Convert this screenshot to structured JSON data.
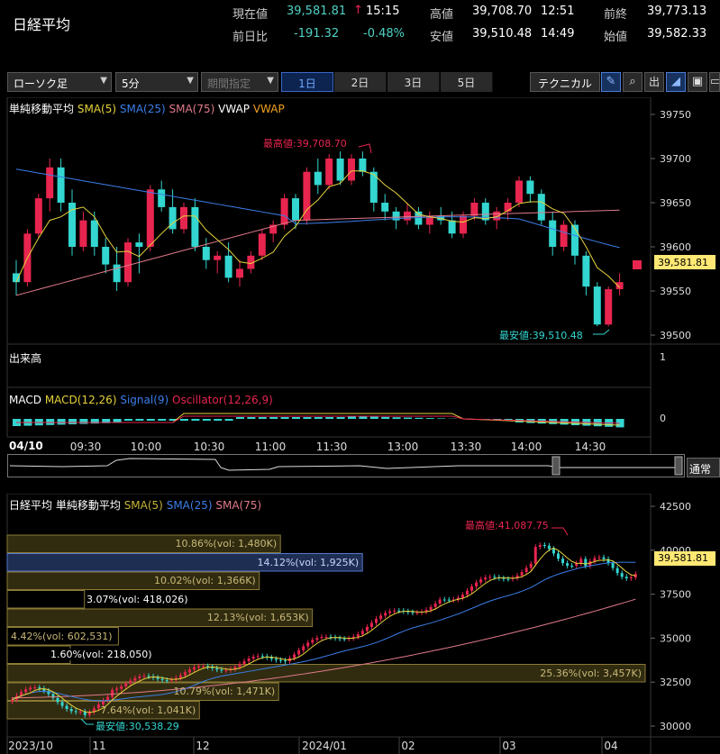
{
  "header": {
    "title": "日経平均",
    "current_label": "現在値",
    "current_value": "39,581.81",
    "current_arrow": "↑",
    "time": "15:15",
    "high_label": "高値",
    "high_value": "39,708.70",
    "high_time": "12:51",
    "prev_close_label": "前終",
    "prev_close_value": "39,773.13",
    "change_label": "前日比",
    "change_value": "-191.32",
    "change_pct": "-0.48%",
    "low_label": "安値",
    "low_value": "39,510.48",
    "low_time": "14:49",
    "open_label": "始値",
    "open_value": "39,582.33"
  },
  "toolbar": {
    "chart_type": "ローソク足",
    "interval": "5分",
    "period": "期間指定",
    "ranges": [
      "1日",
      "2日",
      "3日",
      "5日"
    ],
    "technical": "テクニカル"
  },
  "intraday": {
    "legend_main": "単純移動平均",
    "sma5": "SMA(5)",
    "sma25": "SMA(25)",
    "sma75": "SMA(75)",
    "vwap1": "VWAP",
    "vwap2": "VWAP",
    "high_annot": "最高値:39,708.70",
    "low_annot": "最安値:39,510.48",
    "price_tag": "39,581.81",
    "yticks": [
      "39750",
      "39700",
      "39650",
      "39600",
      "39550",
      "39500"
    ],
    "volume_label": "出来高",
    "volume_tick": "1",
    "macd_title": "MACD",
    "macd_line": "MACD(12,26)",
    "signal": "Signal(9)",
    "oscillator": "Oscillator(12,26,9)",
    "macd_tick": "0",
    "date_label": "04/10",
    "xticks": [
      "09:30",
      "10:00",
      "10:30",
      "11:00",
      "11:30",
      "13:00",
      "13:30",
      "14:00",
      "14:30"
    ],
    "scroll_mode": "通常",
    "colors": {
      "up": "#e8254f",
      "down": "#33d6d0",
      "sma5": "#e6d23c",
      "sma25": "#3b7ee8",
      "sma75": "#e07a8a",
      "vwap": "#ffffff"
    }
  },
  "daily": {
    "title": "日経平均",
    "legend_main": "単純移動平均",
    "sma5": "SMA(5)",
    "sma25": "SMA(25)",
    "sma75": "SMA(75)",
    "high_annot": "最高値:41,087.75",
    "low_annot": "最安値:30,538.29",
    "price_tag": "39,581.81",
    "yticks": [
      "42500",
      "40000",
      "37500",
      "35000",
      "32500",
      "30000"
    ],
    "xticks": [
      "2023/10",
      "11",
      "12",
      "2024/01",
      "02",
      "03",
      "04"
    ],
    "volume_profile": [
      {
        "label": "10.86%(vol: 1,480K)",
        "pct": 10.86
      },
      {
        "label": "14.12%(vol: 1,925K)",
        "pct": 14.12
      },
      {
        "label": "10.02%(vol: 1,366K)",
        "pct": 10.02
      },
      {
        "label": "3.07%(vol: 418,026)",
        "pct": 3.07
      },
      {
        "label": "12.13%(vol: 1,653K)",
        "pct": 12.13
      },
      {
        "label": "4.42%(vol: 602,531)",
        "pct": 4.42
      },
      {
        "label": "1.60%(vol: 218,050)",
        "pct": 1.6
      },
      {
        "label": "25.36%(vol: 3,457K)",
        "pct": 25.36
      },
      {
        "label": "10.79%(vol: 1,471K)",
        "pct": 10.79
      },
      {
        "label": "7.64%(vol: 1,041K)",
        "pct": 7.64
      }
    ]
  }
}
